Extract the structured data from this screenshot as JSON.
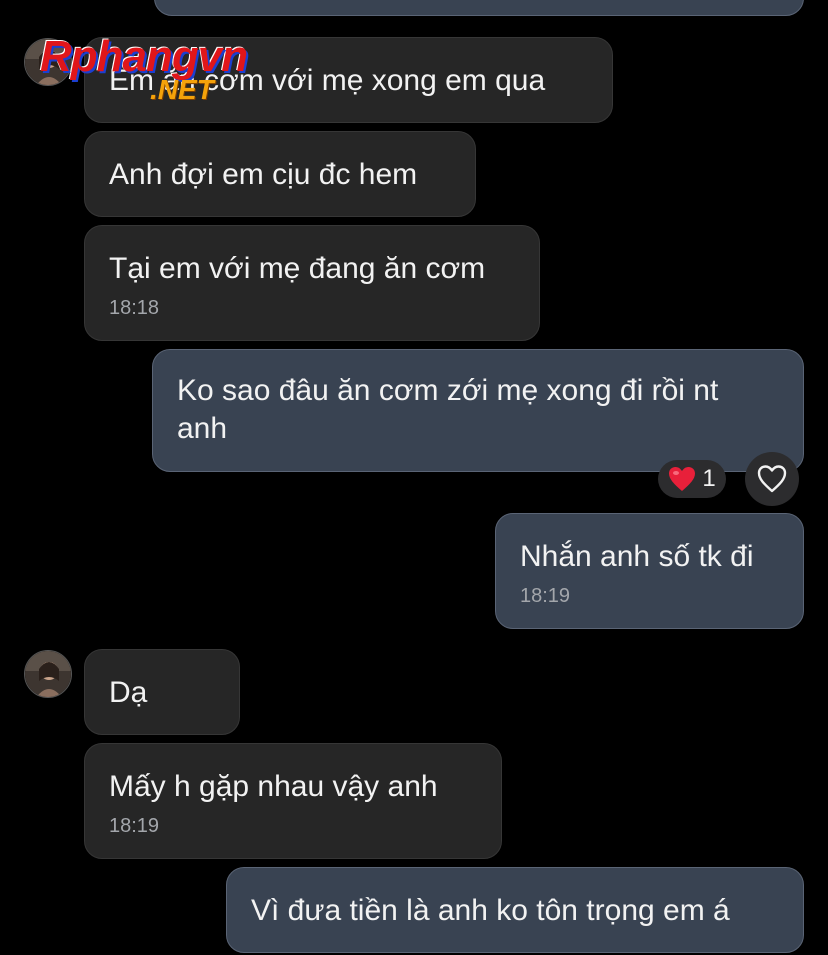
{
  "messages": [
    {
      "text": "Em ăn cơm với mẹ xong em qua"
    },
    {
      "text": "Anh đợi em cịu đc hem"
    },
    {
      "text": "Tại em với mẹ đang ăn cơm",
      "time": "18:18"
    },
    {
      "text": "Ko sao đâu ăn cơm zới mẹ xong đi rồi nt\nanh"
    },
    {
      "text": "Nhắn anh số tk đi",
      "time": "18:19"
    },
    {
      "text": "Dạ"
    },
    {
      "text": "Mấy h gặp nhau vậy anh",
      "time": "18:19"
    },
    {
      "text": "Vì đưa tiền là anh ko tôn trọng em á"
    }
  ],
  "reaction": {
    "emoji": "heart-icon",
    "count": "1"
  },
  "watermark": {
    "main": "Rphangvn",
    "sub": ".NET"
  },
  "colors": {
    "background": "#000000",
    "incoming_bubble": "#262626",
    "outgoing_bubble": "#394352",
    "outgoing_border": "#5a6475",
    "timestamp": "#a3a6ab",
    "heart": "#e8203a",
    "watermark_red": "#e0161a",
    "watermark_orange": "#f5a20a"
  }
}
